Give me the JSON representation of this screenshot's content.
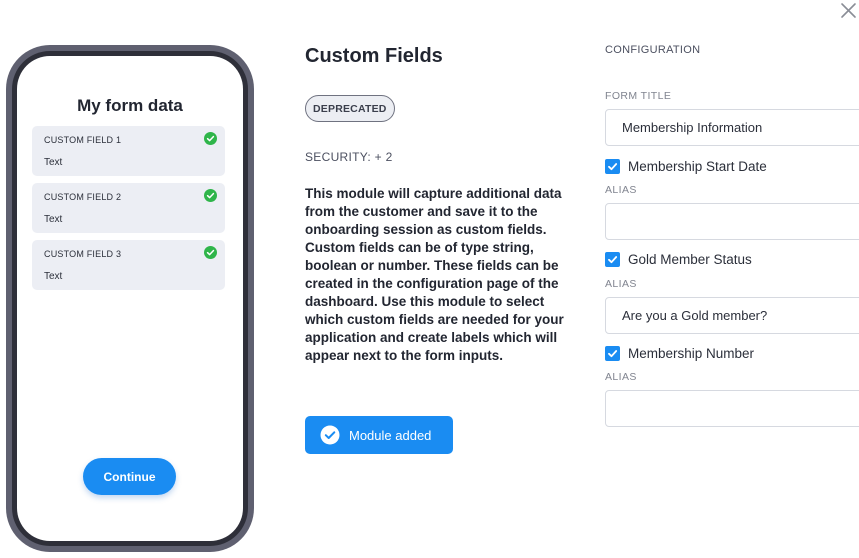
{
  "phone": {
    "title": "My form data",
    "fields": [
      {
        "label": "CUSTOM FIELD 1",
        "type": "Text"
      },
      {
        "label": "CUSTOM FIELD 2",
        "type": "Text"
      },
      {
        "label": "CUSTOM FIELD 3",
        "type": "Text"
      }
    ],
    "continue_label": "Continue"
  },
  "module": {
    "title": "Custom Fields",
    "badge": "DEPRECATED",
    "security": "SECURITY: + 2",
    "description": "This module will capture additional data from the customer and save it to the onboarding session as custom fields. Custom fields can be of type string, boolean or number. These fields can be created in the configuration page of the dashboard. Use this module to select which custom fields are needed for your application and create labels which will appear next to the form inputs.",
    "added_label": "Module added"
  },
  "config": {
    "header": "CONFIGURATION",
    "form_title_label": "FORM TITLE",
    "form_title_value": "Membership Information",
    "items": [
      {
        "label": "Membership Start Date",
        "checked": true,
        "alias_label": "ALIAS",
        "alias_value": ""
      },
      {
        "label": "Gold Member Status",
        "checked": true,
        "alias_label": "ALIAS",
        "alias_value": "Are you a Gold member?"
      },
      {
        "label": "Membership Number",
        "checked": true,
        "alias_label": "ALIAS",
        "alias_value": ""
      }
    ]
  },
  "colors": {
    "accent": "#1a8cf2",
    "success": "#2fb54a",
    "phone_frame": "#5f6070"
  },
  "icons": {
    "close": "close-icon",
    "field_status": "check-circle-icon",
    "module_added": "check-circle-icon",
    "checkbox": "checkmark-icon"
  }
}
